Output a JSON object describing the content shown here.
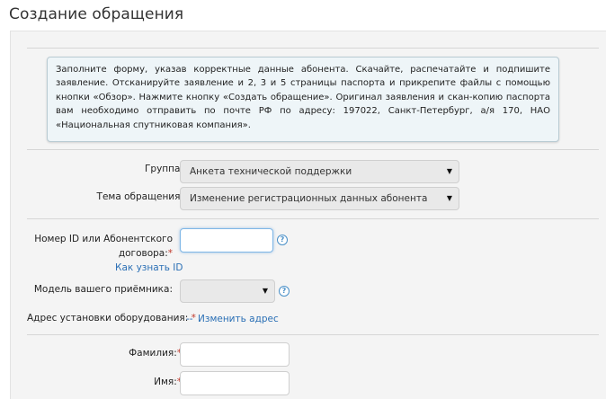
{
  "page": {
    "title": "Создание обращения"
  },
  "info": {
    "text": "Заполните форму, указав корректные данные абонента. Скачайте, распечатайте и подпишите заявление. Отсканируйте заявление и 2, 3 и 5 страницы паспорта и прикрепите файлы с помощью кнопки «Обзор». Нажмите кнопку «Создать обращение». Оригинал заявления и скан-копию паспорта вам необходимо отправить по почте РФ по адресу: 197022, Санкт-Петербург, а/я 170, НАО «Национальная спутниковая компания»."
  },
  "form": {
    "group": {
      "label": "Группа:",
      "value": "Анкета технической поддержки",
      "arrow": "▼"
    },
    "topic": {
      "label": "Тема обращения:",
      "value": "Изменение регистрационных данных абонента",
      "arrow": "▼"
    },
    "account_id": {
      "label_line1": "Номер ID или Абонентского",
      "label_line2": "договора:",
      "required_mark": "*",
      "value": "",
      "help": "?",
      "how_to_link": "Как узнать ID"
    },
    "receiver_model": {
      "label": "Модель вашего приёмника:",
      "value": "",
      "arrow": "▼",
      "help": "?"
    },
    "address": {
      "label": "Адрес установки оборудования:",
      "required_mark": "*",
      "dash": "--",
      "change_link": "Изменить адрес"
    },
    "surname": {
      "label": "Фамилия:",
      "required_mark": "*",
      "value": ""
    },
    "name": {
      "label": "Имя:",
      "required_mark": "*",
      "value": ""
    }
  }
}
